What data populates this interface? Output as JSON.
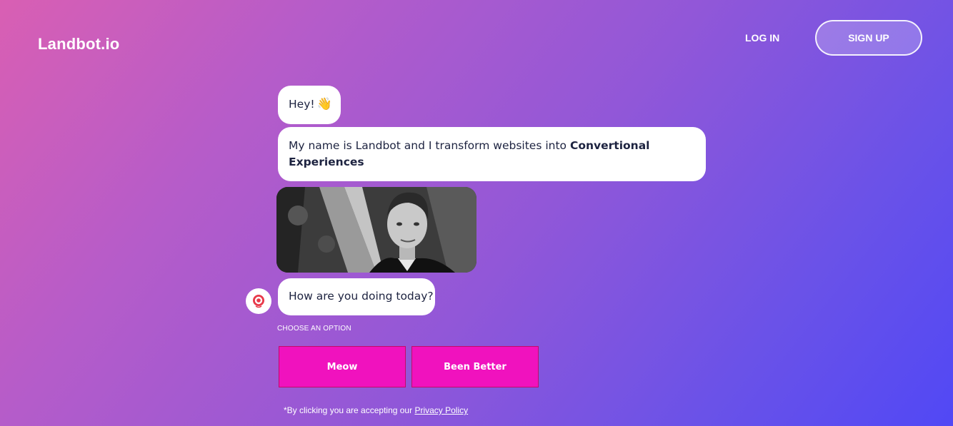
{
  "header": {
    "logo": "Landbot.io",
    "login_label": "LOG IN",
    "signup_label": "SIGN UP"
  },
  "chat": {
    "greeting": "Hey!",
    "greeting_emoji": "👋",
    "intro_text": "My name is Landbot and I transform websites into ",
    "intro_bold": "Convertional Experiences",
    "question": "How are you doing today?",
    "choose_label": "CHOOSE AN OPTION",
    "options": [
      {
        "label": "Meow"
      },
      {
        "label": "Been Better"
      }
    ]
  },
  "footer": {
    "policy_prefix": "*By clicking you are accepting our ",
    "policy_link": "Privacy Policy"
  },
  "colors": {
    "accent_button": "#f012be",
    "bot_avatar": "#e8394a"
  }
}
